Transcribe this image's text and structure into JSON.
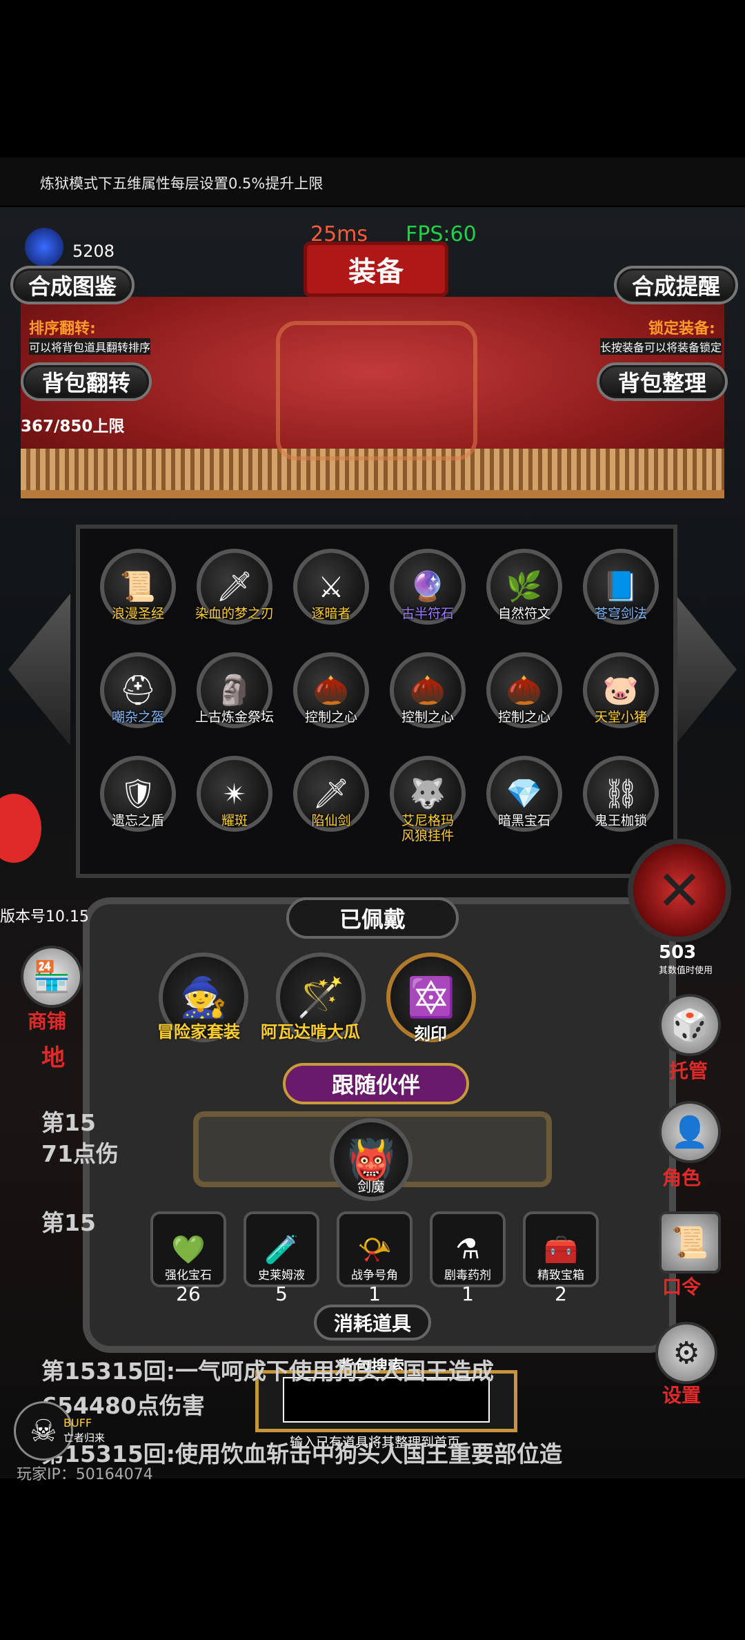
{
  "notice": "炼狱模式下五维属性每层设置0.5%提升上限",
  "hud": {
    "gems": "5208",
    "ping": "25ms",
    "fps": "FPS:60",
    "version": "版本号10.15",
    "player_ip": "玩家IP：50164074"
  },
  "title": "装备",
  "top_buttons": {
    "codex": "合成图鉴",
    "remind": "合成提醒",
    "flip": "背包翻转",
    "sort": "背包整理"
  },
  "hints": {
    "flip_title": "排序翻转:",
    "flip_desc": "可以将背包道具翻转排序",
    "lock_title": "锁定装备:",
    "lock_desc": "长按装备可以将装备锁定"
  },
  "capacity": "367/850上限",
  "items": [
    {
      "name": "浪漫圣经",
      "color": "#ffcf2e",
      "icon": "📜"
    },
    {
      "name": "染血的梦之刃",
      "color": "#ffcf2e",
      "icon": "🗡"
    },
    {
      "name": "逐暗者",
      "color": "#ffcf2e",
      "icon": "⚔"
    },
    {
      "name": "古半符石",
      "color": "#9b7bff",
      "icon": "🔮"
    },
    {
      "name": "自然符文",
      "color": "#ffffff",
      "icon": "🌿"
    },
    {
      "name": "苍穹剑法",
      "color": "#7fb8ff",
      "icon": "📘"
    },
    {
      "name": "嘲杂之盔",
      "color": "#7fb8ff",
      "icon": "⛑"
    },
    {
      "name": "上古炼金祭坛",
      "color": "#ffffff",
      "icon": "🗿"
    },
    {
      "name": "控制之心",
      "color": "#ffffff",
      "icon": "🌰"
    },
    {
      "name": "控制之心",
      "color": "#ffffff",
      "icon": "🌰"
    },
    {
      "name": "控制之心",
      "color": "#ffffff",
      "icon": "🌰"
    },
    {
      "name": "天堂小猪",
      "color": "#ffcf2e",
      "icon": "🐷"
    },
    {
      "name": "遗忘之盾",
      "color": "#ffffff",
      "icon": "🛡"
    },
    {
      "name": "耀斑",
      "color": "#ffcf2e",
      "icon": "✴"
    },
    {
      "name": "陷仙剑",
      "color": "#ffcf2e",
      "icon": "🗡"
    },
    {
      "name": "艾尼格玛\n风狼挂件",
      "color": "#ffcf2e",
      "icon": "🐺"
    },
    {
      "name": "暗黑宝石",
      "color": "#ffffff",
      "icon": "💎"
    },
    {
      "name": "鬼王枷锁",
      "color": "#ffffff",
      "icon": "⛓"
    }
  ],
  "equipped": {
    "title": "已佩戴",
    "slots": [
      {
        "name": "冒险家套装",
        "icon": "🧙"
      },
      {
        "name": "阿瓦达啃大瓜",
        "icon": "🪄"
      },
      {
        "name": "刻印",
        "icon": "🔯"
      }
    ]
  },
  "companion": {
    "title": "跟随伙伴",
    "name": "剑魔",
    "icon": "👹"
  },
  "consumables": {
    "title": "消耗道具",
    "items": [
      {
        "name": "强化宝石",
        "count": "26",
        "icon": "💚"
      },
      {
        "name": "史莱姆液",
        "count": "5",
        "icon": "🧪"
      },
      {
        "name": "战争号角",
        "count": "1",
        "icon": "📯"
      },
      {
        "name": "剧毒药剂",
        "count": "1",
        "icon": "⚗"
      },
      {
        "name": "精致宝箱",
        "count": "2",
        "icon": "🧰"
      }
    ]
  },
  "search": {
    "title": "背包搜索",
    "hint": "输入已有道具将其整理到首页",
    "value": ""
  },
  "side": {
    "shop": "商铺",
    "steward": "托管",
    "role": "角色",
    "code": "口令",
    "settings": "设置",
    "partial": "地"
  },
  "log": [
    "第15",
    "71点伤",
    "第15",
    "第15315回:一气呵成下使用狗头人国王造成",
    "654480点伤害",
    "第15315回:使用饮血斩击中狗头人国王重要部位造"
  ],
  "buff": {
    "label": "BUFF",
    "desc": "亡者归来"
  },
  "side_counter": {
    "value": "503",
    "desc": "其数值时使用"
  }
}
